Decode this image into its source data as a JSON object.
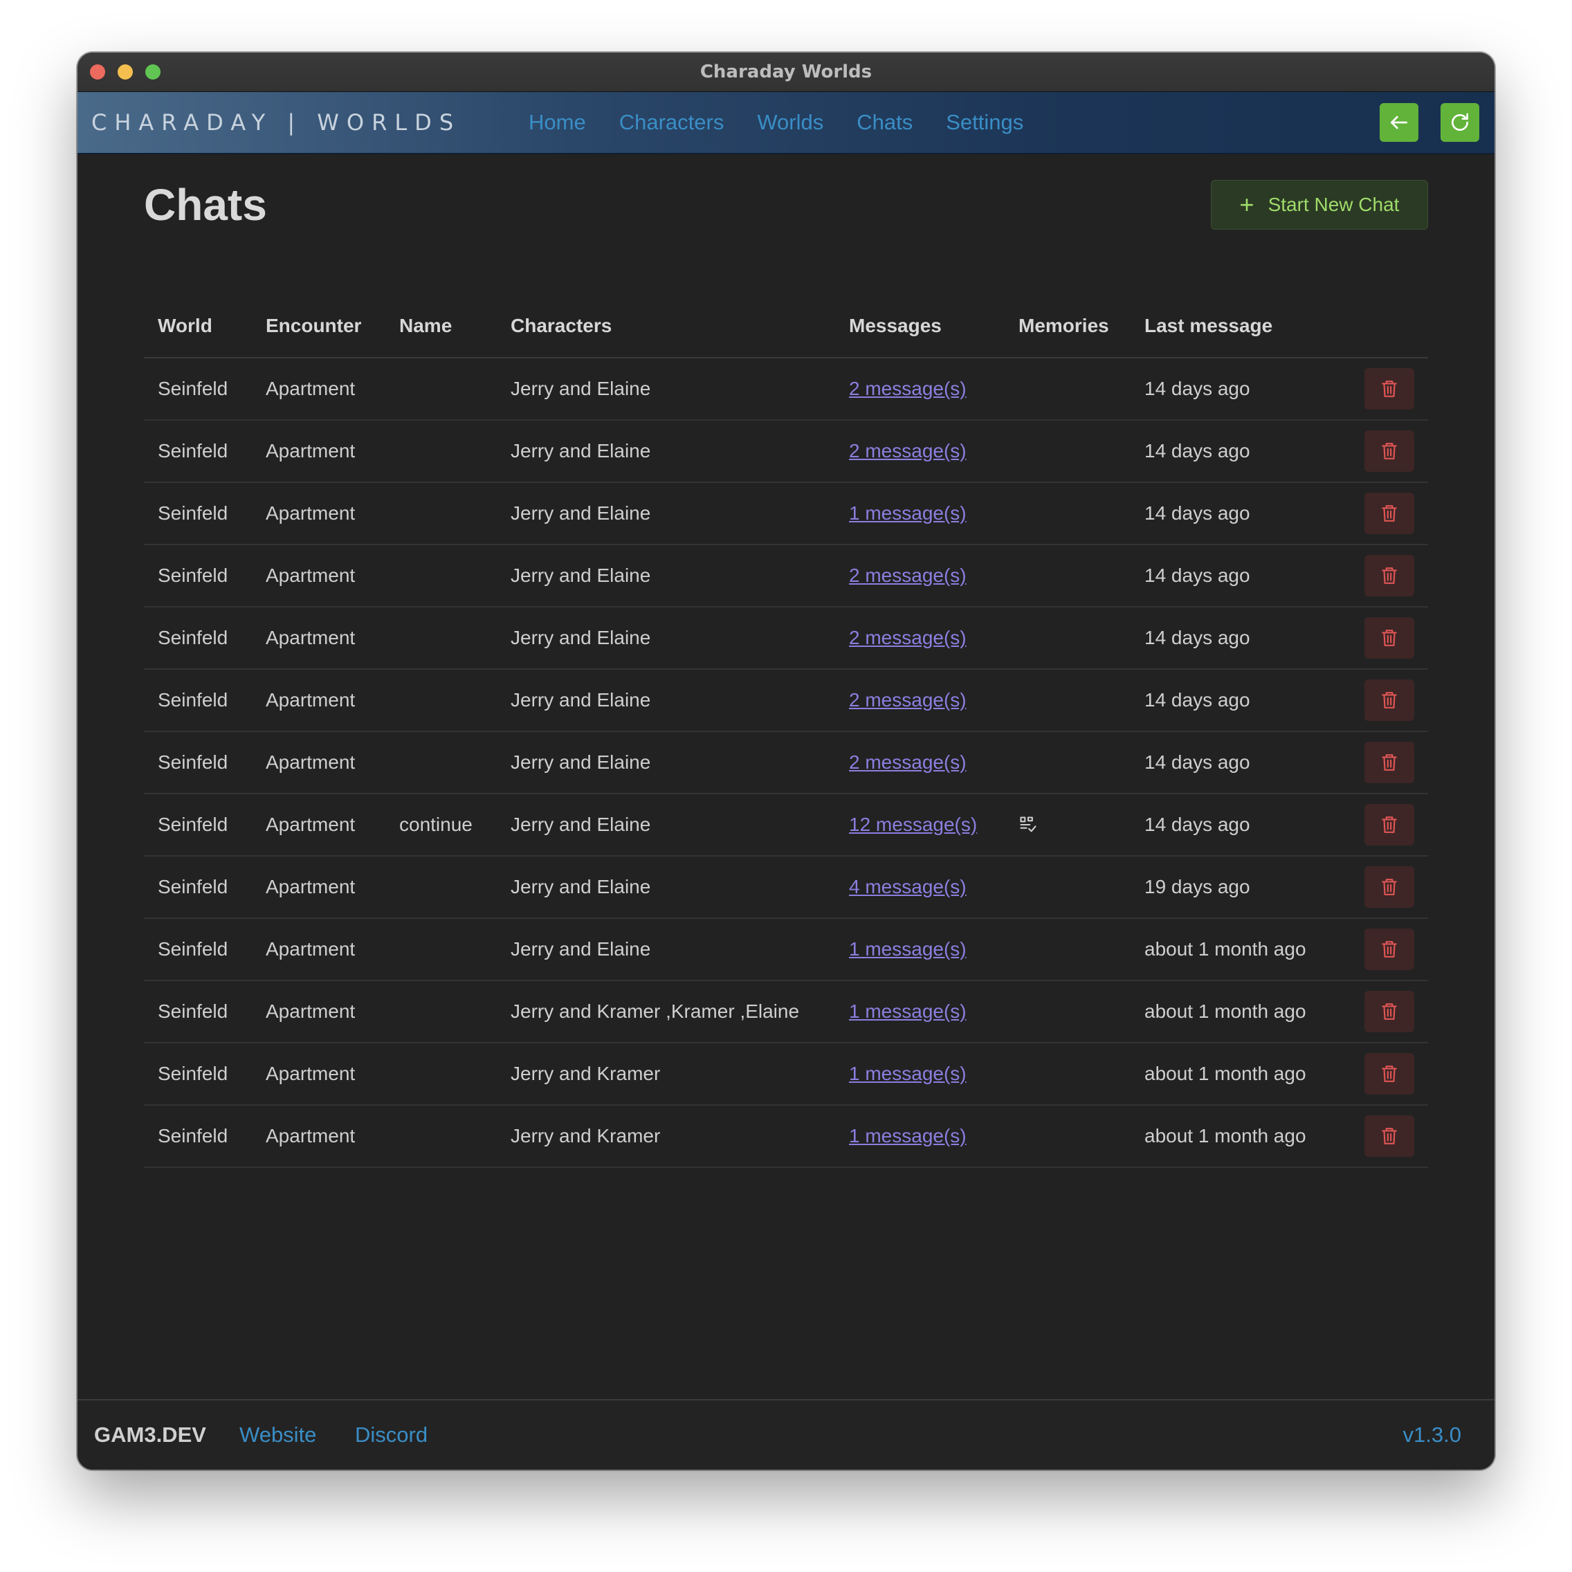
{
  "window": {
    "title": "Charaday Worlds"
  },
  "nav": {
    "brand": "CHARADAY | WORLDS",
    "links": [
      "Home",
      "Characters",
      "Worlds",
      "Chats",
      "Settings"
    ],
    "back_icon": "arrow-left-icon",
    "refresh_icon": "refresh-icon",
    "button_color": "#62b33a"
  },
  "page": {
    "title": "Chats",
    "new_chat_label": "Start New Chat"
  },
  "table": {
    "headers": [
      "World",
      "Encounter",
      "Name",
      "Characters",
      "Messages",
      "Memories",
      "Last message"
    ],
    "rows": [
      {
        "world": "Seinfeld",
        "encounter": "Apartment",
        "name": "",
        "characters": "Jerry and Elaine",
        "messages": "2 message(s)",
        "memories": false,
        "last": "14 days ago"
      },
      {
        "world": "Seinfeld",
        "encounter": "Apartment",
        "name": "",
        "characters": "Jerry and Elaine",
        "messages": "2 message(s)",
        "memories": false,
        "last": "14 days ago"
      },
      {
        "world": "Seinfeld",
        "encounter": "Apartment",
        "name": "",
        "characters": "Jerry and Elaine",
        "messages": "1 message(s)",
        "memories": false,
        "last": "14 days ago"
      },
      {
        "world": "Seinfeld",
        "encounter": "Apartment",
        "name": "",
        "characters": "Jerry and Elaine",
        "messages": "2 message(s)",
        "memories": false,
        "last": "14 days ago"
      },
      {
        "world": "Seinfeld",
        "encounter": "Apartment",
        "name": "",
        "characters": "Jerry and Elaine",
        "messages": "2 message(s)",
        "memories": false,
        "last": "14 days ago"
      },
      {
        "world": "Seinfeld",
        "encounter": "Apartment",
        "name": "",
        "characters": "Jerry and Elaine",
        "messages": "2 message(s)",
        "memories": false,
        "last": "14 days ago"
      },
      {
        "world": "Seinfeld",
        "encounter": "Apartment",
        "name": "",
        "characters": "Jerry and Elaine",
        "messages": "2 message(s)",
        "memories": false,
        "last": "14 days ago"
      },
      {
        "world": "Seinfeld",
        "encounter": "Apartment",
        "name": "continue",
        "characters": "Jerry and Elaine",
        "messages": "12 message(s)",
        "memories": true,
        "last": "14 days ago"
      },
      {
        "world": "Seinfeld",
        "encounter": "Apartment",
        "name": "",
        "characters": "Jerry and Elaine",
        "messages": "4 message(s)",
        "memories": false,
        "last": "19 days ago"
      },
      {
        "world": "Seinfeld",
        "encounter": "Apartment",
        "name": "",
        "characters": "Jerry and Elaine",
        "messages": "1 message(s)",
        "memories": false,
        "last": "about 1 month ago"
      },
      {
        "world": "Seinfeld",
        "encounter": "Apartment",
        "name": "",
        "characters": "Jerry and Kramer ,Kramer ,Elaine",
        "messages": "1 message(s)",
        "memories": false,
        "last": "about 1 month ago"
      },
      {
        "world": "Seinfeld",
        "encounter": "Apartment",
        "name": "",
        "characters": "Jerry and Kramer",
        "messages": "1 message(s)",
        "memories": false,
        "last": "about 1 month ago"
      },
      {
        "world": "Seinfeld",
        "encounter": "Apartment",
        "name": "",
        "characters": "Jerry and Kramer",
        "messages": "1 message(s)",
        "memories": false,
        "last": "about 1 month ago"
      }
    ],
    "memory_icon": "memory-check-icon",
    "delete_icon": "trash-icon",
    "link_color": "#8b7fe0",
    "delete_color": "#e05555"
  },
  "footer": {
    "brand": "GAM3.DEV",
    "links": [
      "Website",
      "Discord"
    ],
    "version": "v1.3.0"
  }
}
